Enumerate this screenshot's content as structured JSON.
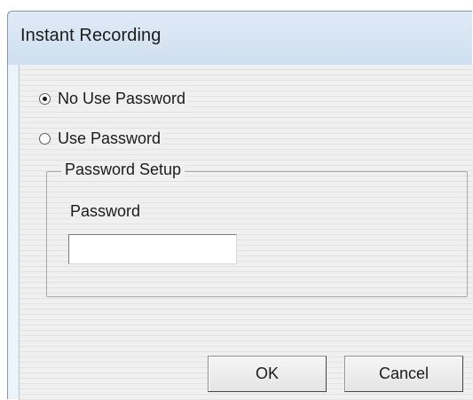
{
  "window": {
    "title": "Instant Recording"
  },
  "options": {
    "no_use_password": {
      "label": "No Use Password",
      "checked": true
    },
    "use_password": {
      "label": "Use Password",
      "checked": false
    }
  },
  "password_setup": {
    "group_title": "Password Setup",
    "field_label": "Password",
    "value": ""
  },
  "buttons": {
    "ok": "OK",
    "cancel": "Cancel"
  }
}
